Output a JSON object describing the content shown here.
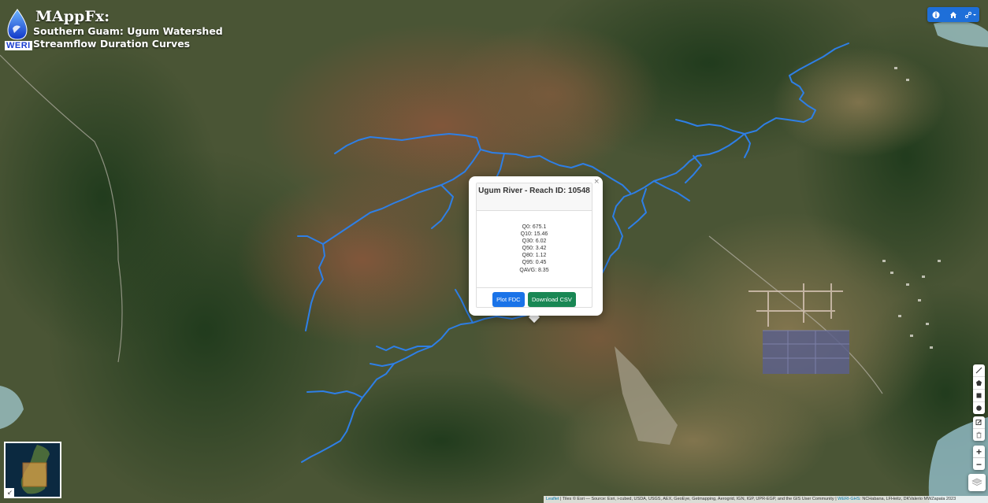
{
  "app": {
    "title": "MAppFx:",
    "subtitle_line1": "Southern Guam: Ugum Watershed",
    "subtitle_line2": "Streamflow Duration Curves",
    "logo_text": "WERI"
  },
  "top_controls": {
    "icons": [
      "info-icon",
      "home-icon",
      "share-icon"
    ]
  },
  "draw_toolbar": {
    "icons": [
      "polyline-icon",
      "polygon-icon",
      "rectangle-icon",
      "circle-icon"
    ],
    "edit_icons": [
      "edit-icon",
      "trash-icon"
    ]
  },
  "zoom": {
    "in_label": "+",
    "out_label": "−"
  },
  "popup": {
    "title": "Ugum River - Reach ID: 10548",
    "close_label": "×",
    "stats": [
      "Q0: 675.1",
      "Q10: 15.46",
      "Q30: 6.02",
      "Q50: 3.42",
      "Q80: 1.12",
      "Q95: 0.45",
      "QAVG: 8.35"
    ],
    "plot_button": "Plot FDC",
    "download_button": "Download CSV"
  },
  "minimap": {
    "toggle_label": "↙"
  },
  "attribution": {
    "leaflet": "Leaflet",
    "tiles": " | Tiles © Esri — Source: Esri, i-cubed, USDA, USGS, AEX, GeoEye, Getmapping, Aerogrid, IGN, IGP, UPR-EGP, and the GIS User Community | ",
    "weri": "WERI-GHS",
    "credits": ": NCHabana, LFHeitz, DKValerio MWZapata 2023"
  },
  "colors": {
    "river": "#2e7fe6",
    "button_blue": "#1a73e8",
    "button_green": "#198754",
    "control_blue": "#1e6fd9"
  }
}
